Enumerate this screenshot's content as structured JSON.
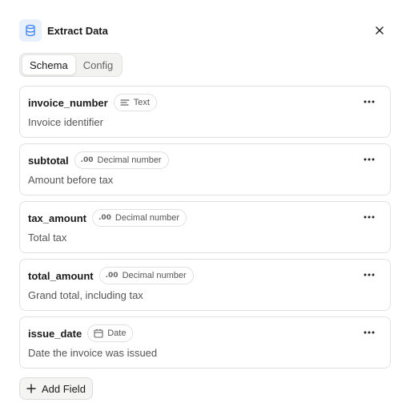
{
  "panel": {
    "title": "Extract Data",
    "header_icon": "database-icon",
    "close_icon": "close-icon",
    "accent_color": "#3b82f6"
  },
  "tabs": [
    {
      "label": "Schema",
      "active": true
    },
    {
      "label": "Config",
      "active": false
    }
  ],
  "fields": [
    {
      "name": "invoice_number",
      "type": "Text",
      "type_icon": "text-lines-icon",
      "description": "Invoice identifier"
    },
    {
      "name": "subtotal",
      "type": "Decimal number",
      "type_icon": "decimal-icon",
      "description": "Amount before tax"
    },
    {
      "name": "tax_amount",
      "type": "Decimal number",
      "type_icon": "decimal-icon",
      "description": "Total tax"
    },
    {
      "name": "total_amount",
      "type": "Decimal number",
      "type_icon": "decimal-icon",
      "description": "Grand total, including tax"
    },
    {
      "name": "issue_date",
      "type": "Date",
      "type_icon": "calendar-icon",
      "description": "Date the invoice was issued"
    }
  ],
  "add_field_label": "Add Field"
}
